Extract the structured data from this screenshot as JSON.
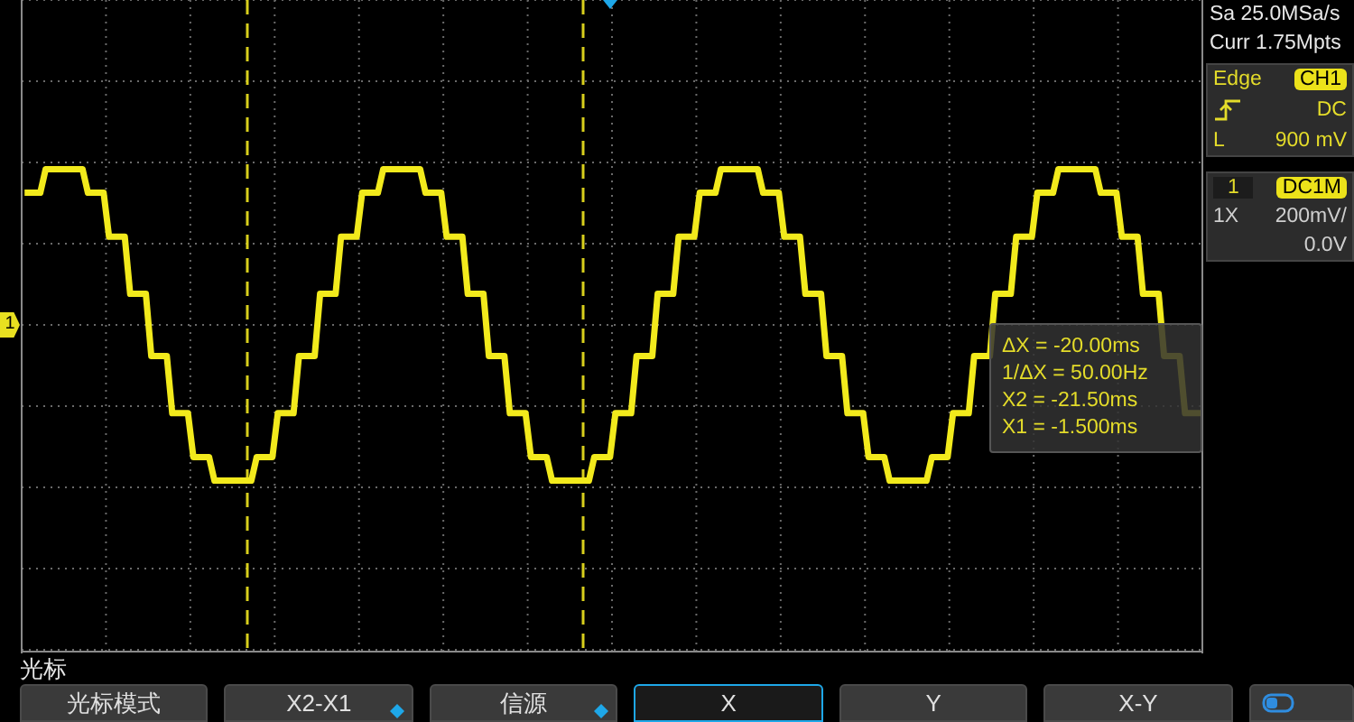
{
  "acquisition": {
    "sample_rate": "Sa 25.0MSa/s",
    "memory_depth": "Curr 1.75Mpts"
  },
  "trigger": {
    "type": "Edge",
    "source": "CH1",
    "coupling": "DC",
    "threshold_label": "L",
    "threshold": "900 mV"
  },
  "channel": {
    "number": "1",
    "coupling": "DC1M",
    "probe": "1X",
    "scale": "200mV/",
    "offset": "0.0V"
  },
  "channel_marker": "1",
  "cursor_readout": [
    "ΔX = -20.00ms",
    "1/ΔX = 50.00Hz",
    "X2 = -21.50ms",
    "X1 = -1.500ms"
  ],
  "menu": {
    "title": "光标",
    "buttons": [
      {
        "label": "光标模式",
        "kind": "plain",
        "selected": false
      },
      {
        "label": "X2-X1",
        "kind": "dropdown",
        "selected": false
      },
      {
        "label": "信源",
        "kind": "dropdown",
        "selected": false
      },
      {
        "label": "X",
        "kind": "plain",
        "selected": true
      },
      {
        "label": "Y",
        "kind": "plain",
        "selected": false
      },
      {
        "label": "X-Y",
        "kind": "plain",
        "selected": false
      },
      {
        "kind": "toggle",
        "selected": false
      }
    ]
  }
}
